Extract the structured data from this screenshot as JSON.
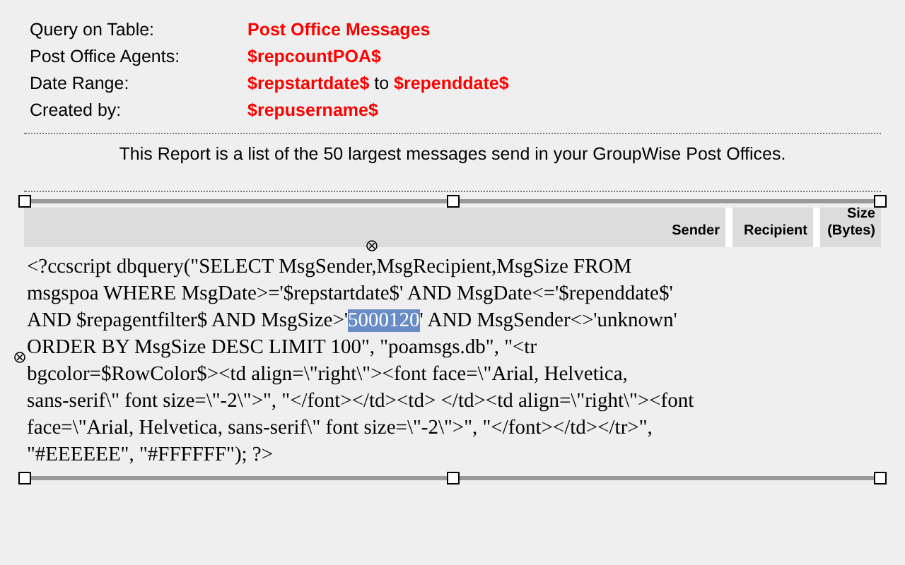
{
  "info_rows": [
    {
      "label": "Query on Table:",
      "value": "Post Office Messages"
    },
    {
      "label": "Post Office Agents:",
      "value": "$repcountPOA$"
    },
    {
      "label": "Date Range:",
      "value": "**$repstartdate$** to **$rependdate$**"
    },
    {
      "label": "Created by:",
      "value": "$repusername$"
    }
  ],
  "description": "This Report is a list of the 50 largest messages send in your GroupWise Post Offices.",
  "table": {
    "columns": [
      "Sender",
      "Recipient",
      "Size (Bytes)"
    ]
  },
  "code_lines": [
    {
      "segments": [
        {
          "text": "<?ccscript dbquery(\"SELECT MsgSender,MsgRecipient,MsgSize FROM",
          "selected": false
        }
      ]
    },
    {
      "segments": [
        {
          "text": "msgspoa WHERE MsgDate>='$repstartdate$' AND MsgDate<='$rependdate$'",
          "selected": false
        }
      ]
    },
    {
      "segments": [
        {
          "text": "AND $repagentfilter$ AND MsgSize>'",
          "selected": false
        },
        {
          "text": "5000120",
          "selected": true
        },
        {
          "text": "' AND MsgSender<>'unknown'",
          "selected": false
        }
      ]
    },
    {
      "segments": [
        {
          "text": "ORDER BY MsgSize DESC LIMIT 100\", \"poamsgs.db\", \"<tr",
          "selected": false
        }
      ]
    },
    {
      "segments": [
        {
          "text": "bgcolor=$RowColor$><td align=\\\"right\\\"><font face=\\\"Arial, Helvetica,",
          "selected": false
        }
      ]
    },
    {
      "segments": [
        {
          "text": "sans-serif\\\" font size=\\\"-2\\\">\", \"</font></td><td> </td><td align=\\\"right\\\"><font",
          "selected": false
        }
      ]
    },
    {
      "segments": [
        {
          "text": "face=\\\"Arial, Helvetica, sans-serif\\\" font size=\\\"-2\\\">\", \"</font></td></tr>\",",
          "selected": false
        }
      ]
    },
    {
      "segments": [
        {
          "text": "\"#EEEEEE\", \"#FFFFFF\"); ?>",
          "selected": false
        }
      ]
    }
  ]
}
